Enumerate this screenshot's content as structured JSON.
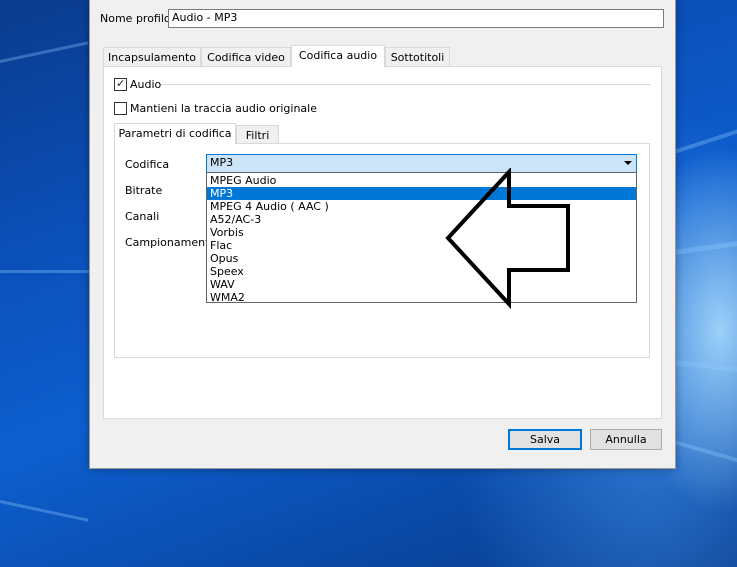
{
  "profile": {
    "name_label": "Nome profilo",
    "name_value": "Audio - MP3"
  },
  "tabs": [
    {
      "label": "Incapsulamento"
    },
    {
      "label": "Codifica video"
    },
    {
      "label": "Codifica audio"
    },
    {
      "label": "Sottotitoli"
    }
  ],
  "audio_tab": {
    "audio_checkbox_label": "Audio",
    "audio_checked": true,
    "keep_original_label": "Mantieni la traccia audio originale",
    "keep_original_checked": false,
    "subtabs": [
      {
        "label": "Parametri di codifica"
      },
      {
        "label": "Filtri"
      }
    ],
    "fields": {
      "codec_label": "Codifica",
      "bitrate_label": "Bitrate",
      "channels_label": "Canali",
      "samplerate_label": "Campionamento"
    },
    "codec_selected": "MP3",
    "codec_options": [
      "MPEG Audio",
      "MP3",
      "MPEG 4 Audio ( AAC )",
      "A52/AC-3",
      "Vorbis",
      "Flac",
      "Opus",
      "Speex",
      "WAV",
      "WMA2"
    ]
  },
  "buttons": {
    "save_label": "Salva",
    "cancel_label": "Annulla"
  },
  "colors": {
    "accent": "#0078d7",
    "desktop": "#0b4fb8",
    "dialog_bg": "#f0f0f0"
  }
}
